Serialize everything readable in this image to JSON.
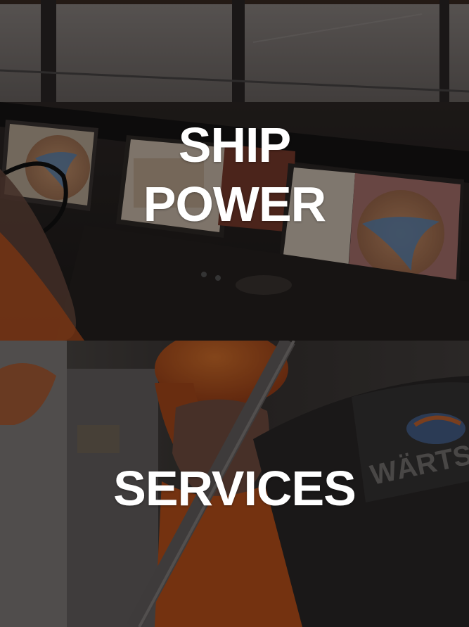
{
  "tiles": {
    "top": {
      "title_line_1": "SHIP",
      "title_line_2": "POWER"
    },
    "bottom": {
      "title": "SERVICES"
    }
  },
  "colors": {
    "overlay": "#000000",
    "text": "#ffffff",
    "hardhat": "#c8561c",
    "screen": "#c9b9a6",
    "radar_circle": "#b07a52",
    "radar_blue": "#5b85b3"
  }
}
